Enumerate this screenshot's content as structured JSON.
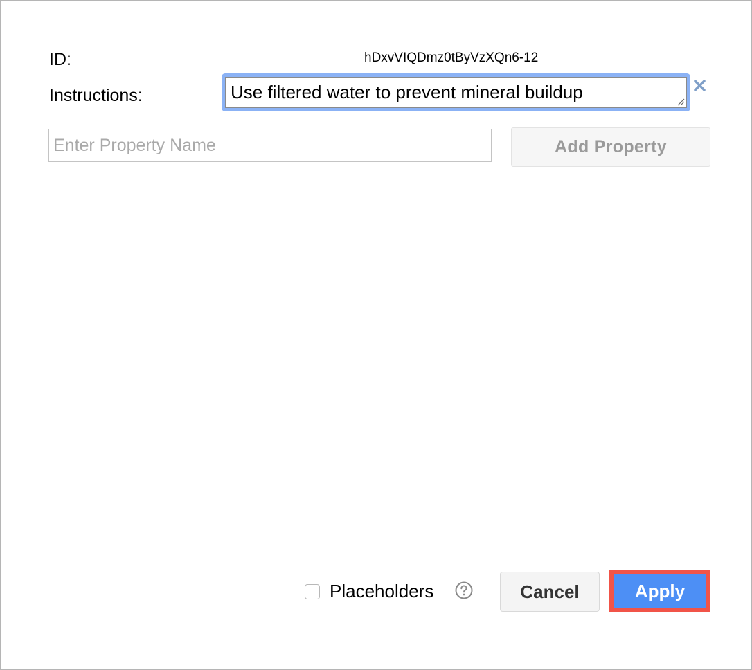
{
  "dialog": {
    "id_label": "ID:",
    "id_value": "hDxvVIQDmz0tByVzXQn6-12",
    "fields": [
      {
        "label": "Instructions:",
        "value": "Use filtered water to prevent mineral buildup",
        "remove_icon": "close-icon"
      }
    ],
    "new_property": {
      "placeholder": "Enter Property Name",
      "value": "",
      "add_button_label": "Add Property",
      "add_button_enabled": false
    },
    "footer": {
      "placeholders_label": "Placeholders",
      "placeholders_checked": false,
      "help_icon": "help-circle-icon",
      "cancel_label": "Cancel",
      "apply_label": "Apply"
    }
  },
  "colors": {
    "focus_ring": "#8bb2f5",
    "primary_button": "#4d8ff5",
    "highlight_annotation": "#f15448",
    "close_icon": "#7f9fc8"
  }
}
